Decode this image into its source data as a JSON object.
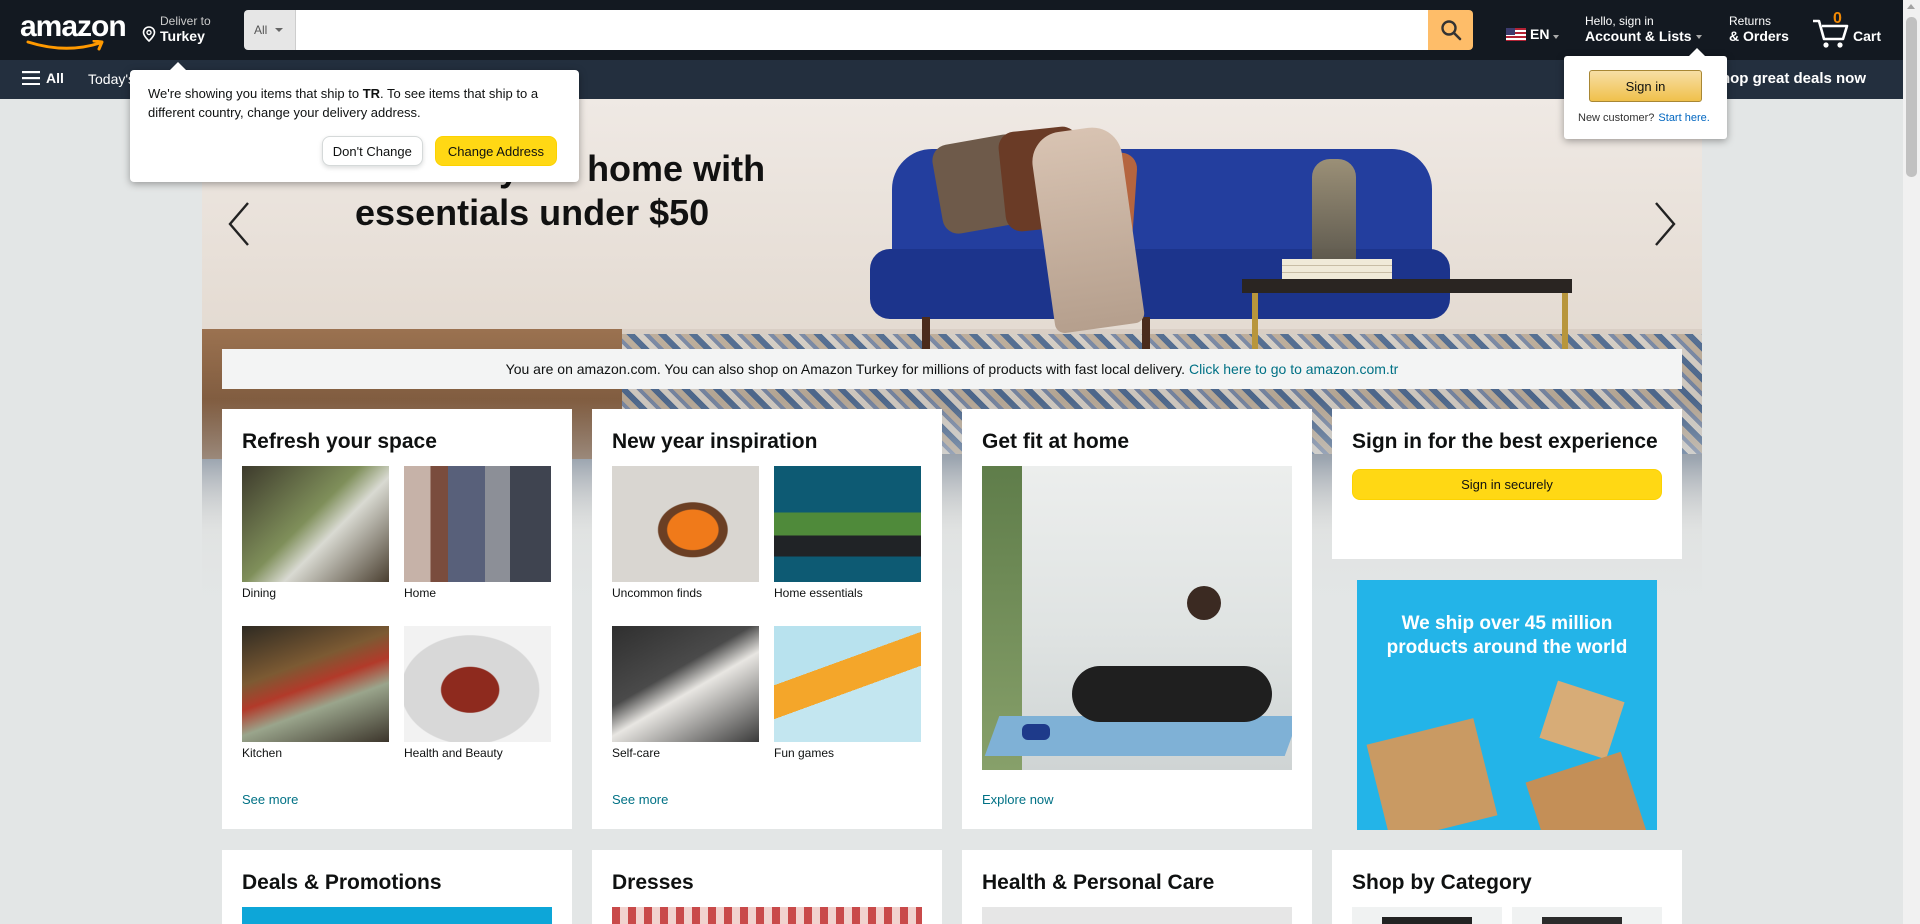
{
  "header": {
    "logo_text": "amazon",
    "deliver_line1": "Deliver to",
    "deliver_line2": "Turkey",
    "search_category": "All",
    "search_placeholder": "",
    "language": "EN",
    "account_line1": "Hello, sign in",
    "account_line2": "Account & Lists",
    "returns_line1": "Returns",
    "returns_line2": "& Orders",
    "cart_count": "0",
    "cart_label": "Cart"
  },
  "subnav": {
    "all_label": "All",
    "today_label": "Today's Deals",
    "promo_label": "Shop great deals now"
  },
  "delivery_popover": {
    "text_before": "We're showing you items that ship to ",
    "country_code": "TR",
    "text_after": ". To see items that ship to a different country, change your delivery address.",
    "dont_change": "Don't Change",
    "change_address": "Change Address"
  },
  "signin_flyout": {
    "button": "Sign in",
    "new_customer": "New customer?",
    "start_here": "Start here."
  },
  "hero": {
    "title": "Refresh your home with essentials under $50"
  },
  "notice": {
    "text": "You are on amazon.com. You can also shop on Amazon Turkey for millions of products with fast local delivery.",
    "link": "Click here to go to amazon.com.tr"
  },
  "cards": {
    "refresh": {
      "title": "Refresh your space",
      "items": [
        "Dining",
        "Home",
        "Kitchen",
        "Health and Beauty"
      ],
      "link": "See more"
    },
    "newyear": {
      "title": "New year inspiration",
      "items": [
        "Uncommon finds",
        "Home essentials",
        "Self-care",
        "Fun games"
      ],
      "link": "See more"
    },
    "fit": {
      "title": "Get fit at home",
      "link": "Explore now"
    },
    "signin": {
      "title": "Sign in for the best experience",
      "button": "Sign in securely"
    },
    "ship_ad": {
      "text": "We ship over 45 million products around the world"
    }
  },
  "row2_titles": [
    "Deals & Promotions",
    "Dresses",
    "Health & Personal Care",
    "Shop by Category"
  ],
  "colors": {
    "nav_dark": "#131921",
    "nav_sub": "#232f3e",
    "search_button": "#febd69",
    "cta_yellow": "#ffd814",
    "link_teal": "#007185",
    "cart_orange": "#f08804"
  }
}
